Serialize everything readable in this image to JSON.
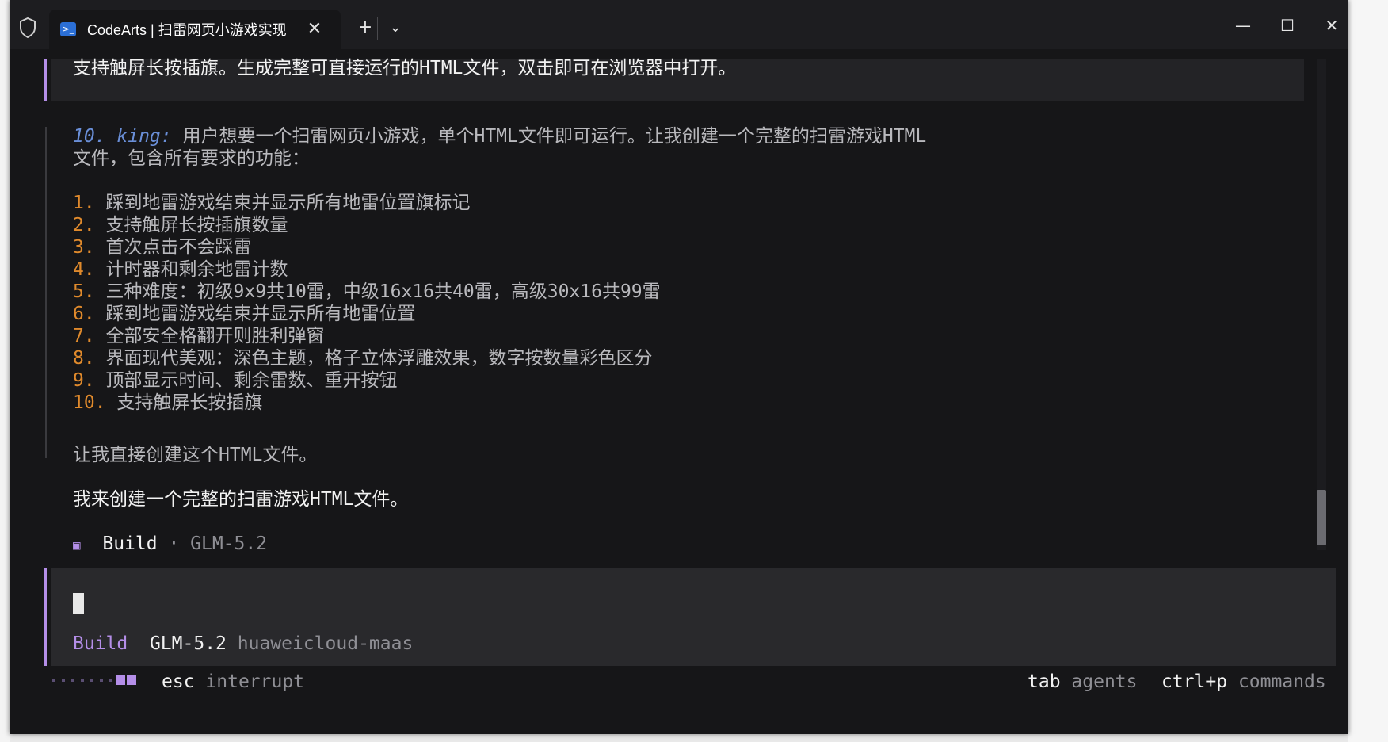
{
  "window": {
    "tab_title": "CodeArts | 扫雷网页小游戏实现",
    "tab_icon": "powershell-icon",
    "new_tab": "+",
    "dropdown": "⌄",
    "close_tab": "✕",
    "minimize": "—",
    "maximize": "☐",
    "close": "✕"
  },
  "conversation": {
    "prompt_tail": "支持触屏长按插旗。生成完整可直接运行的HTML文件，双击即可在浏览器中打开。",
    "thinking": {
      "label": "10. king:",
      "line1": " 用户想要一个扫雷网页小游戏，单个HTML文件即可运行。让我创建一个完整的扫雷游戏HTML",
      "line2": "文件，包含所有要求的功能：",
      "items": [
        {
          "num": "1.",
          "text": " 踩到地雷游戏结束并显示所有地雷位置旗标记"
        },
        {
          "num": "2.",
          "text": " 支持触屏长按插旗数量"
        },
        {
          "num": "3.",
          "text": " 首次点击不会踩雷"
        },
        {
          "num": "4.",
          "text": " 计时器和剩余地雷计数"
        },
        {
          "num": "5.",
          "text": " 三种难度：初级9x9共10雷，中级16x16共40雷，高级30x16共99雷"
        },
        {
          "num": "6.",
          "text": " 踩到地雷游戏结束并显示所有地雷位置"
        },
        {
          "num": "7.",
          "text": " 全部安全格翻开则胜利弹窗"
        },
        {
          "num": "8.",
          "text": " 界面现代美观：深色主题，格子立体浮雕效果，数字按数量彩色区分"
        },
        {
          "num": "9.",
          "text": " 顶部显示时间、剩余雷数、重开按钮"
        },
        {
          "num": "10.",
          "text": " 支持触屏长按插旗"
        }
      ],
      "closing": "让我直接创建这个HTML文件。"
    },
    "assistant_reply": "我来创建一个完整的扫雷游戏HTML文件。",
    "build_status": {
      "icon": "▣",
      "mode": "Build",
      "sep": " · ",
      "model": "GLM-5.2"
    }
  },
  "input": {
    "mode": "Build",
    "model": "GLM-5.2",
    "provider": "huaweicloud-maas"
  },
  "footer": {
    "esc_key": "esc",
    "esc_action": "interrupt",
    "tab_key": "tab",
    "tab_action": "agents",
    "ctrlp_key": "ctrl+p",
    "ctrlp_action": "commands"
  },
  "colors": {
    "accent": "#b48ee8",
    "number": "#e08a2c",
    "thinking_label": "#6a8fd8",
    "background": "#161618"
  }
}
